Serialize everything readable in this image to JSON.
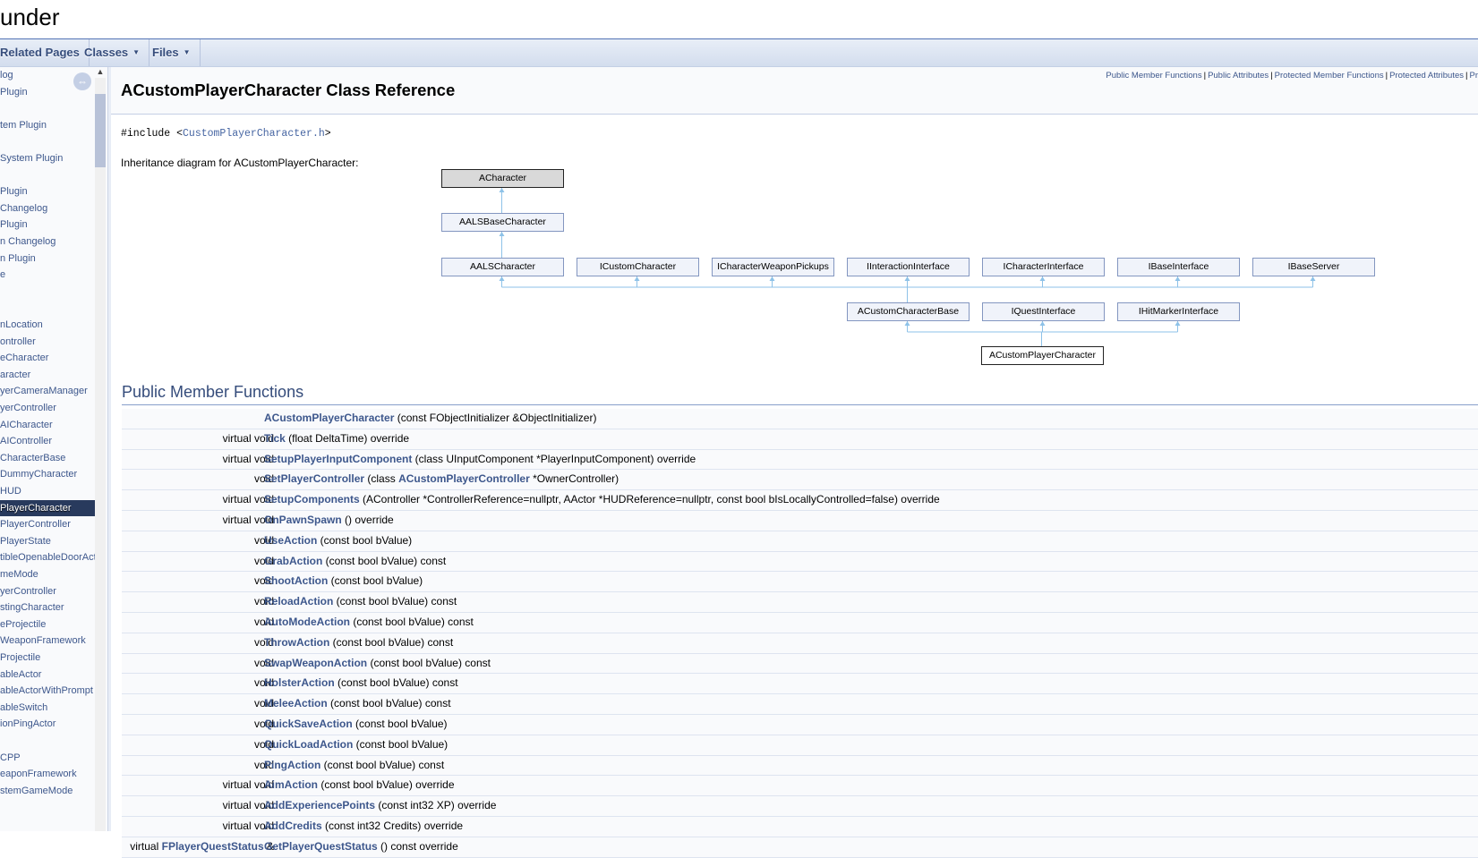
{
  "project": {
    "name": "under"
  },
  "nav": {
    "items": [
      {
        "label": "Related Pages",
        "has_dropdown": false
      },
      {
        "label": "Classes",
        "has_dropdown": true
      },
      {
        "label": "Files",
        "has_dropdown": true
      }
    ],
    "caret": "▼"
  },
  "sidenav": {
    "sync_icon": "⇔",
    "scroll_up": "▲",
    "items": [
      "log",
      "Plugin",
      "",
      "tem Plugin",
      "",
      "System Plugin",
      "",
      "Plugin",
      "Changelog",
      "Plugin",
      "n Changelog",
      "n Plugin",
      "e",
      "",
      "",
      "nLocation",
      "ontroller",
      "eCharacter",
      "aracter",
      "yerCameraManager",
      "yerController",
      "AICharacter",
      "AIController",
      "CharacterBase",
      "DummyCharacter",
      "HUD",
      "PlayerCharacter",
      "PlayerController",
      "PlayerState",
      "tibleOpenableDoorActor",
      "meMode",
      "yerController",
      "stingCharacter",
      "eProjectile",
      "WeaponFramework",
      "Projectile",
      "ableActor",
      "ableActorWithPrompt",
      "ableSwitch",
      "ionPingActor",
      "",
      "CPP",
      "eaponFramework",
      "stemGameMode"
    ],
    "selected_index": 26
  },
  "summary_links": [
    "Public Member Functions",
    "Public Attributes",
    "Protected Member Functions",
    "Protected Attributes",
    "Pr"
  ],
  "page": {
    "title": "ACustomPlayerCharacter Class Reference",
    "include_prefix": "#include <",
    "include_file": "CustomPlayerCharacter.h",
    "include_suffix": ">",
    "inheritance_label": "Inheritance diagram for ACustomPlayerCharacter:"
  },
  "diagram": {
    "root": "ACharacter",
    "level1": "AALSBaseCharacter",
    "level2": [
      "AALSCharacter",
      "ICustomCharacter",
      "ICharacterWeaponPickups",
      "IInteractionInterface",
      "ICharacterInterface",
      "IBaseInterface",
      "IBaseServer"
    ],
    "level3": [
      "ACustomCharacterBase",
      "IQuestInterface",
      "IHitMarkerInterface"
    ],
    "current": "ACustomPlayerCharacter",
    "line_color": "#8ec2e8"
  },
  "section": {
    "title": "Public Member Functions"
  },
  "members": [
    {
      "ret": "",
      "name": "ACustomPlayerCharacter",
      "sig": " (const FObjectInitializer &ObjectInitializer)"
    },
    {
      "ret": "virtual void",
      "name": "Tick",
      "sig": " (float DeltaTime) override"
    },
    {
      "ret": "virtual void",
      "name": "SetupPlayerInputComponent",
      "sig": " (class UInputComponent *PlayerInputComponent) override"
    },
    {
      "ret": "void",
      "name": "SetPlayerController",
      "sig_pre": " (class ",
      "sig_link": "ACustomPlayerController",
      "sig": " *OwnerController)"
    },
    {
      "ret": "virtual void",
      "name": "SetupComponents",
      "sig": " (AController *ControllerReference=nullptr, AActor *HUDReference=nullptr, const bool bIsLocallyControlled=false) override"
    },
    {
      "ret": "virtual void",
      "name": "OnPawnSpawn",
      "sig": " () override"
    },
    {
      "ret": "void",
      "name": "UseAction",
      "sig": " (const bool bValue)"
    },
    {
      "ret": "void",
      "name": "GrabAction",
      "sig": " (const bool bValue) const"
    },
    {
      "ret": "void",
      "name": "ShootAction",
      "sig": " (const bool bValue)"
    },
    {
      "ret": "void",
      "name": "ReloadAction",
      "sig": " (const bool bValue) const"
    },
    {
      "ret": "void",
      "name": "AutoModeAction",
      "sig": " (const bool bValue) const"
    },
    {
      "ret": "void",
      "name": "ThrowAction",
      "sig": " (const bool bValue) const"
    },
    {
      "ret": "void",
      "name": "SwapWeaponAction",
      "sig": " (const bool bValue) const"
    },
    {
      "ret": "void",
      "name": "HolsterAction",
      "sig": " (const bool bValue) const"
    },
    {
      "ret": "void",
      "name": "MeleeAction",
      "sig": " (const bool bValue) const"
    },
    {
      "ret": "void",
      "name": "QuickSaveAction",
      "sig": " (const bool bValue)"
    },
    {
      "ret": "void",
      "name": "QuickLoadAction",
      "sig": " (const bool bValue)"
    },
    {
      "ret": "void",
      "name": "PingAction",
      "sig": " (const bool bValue) const"
    },
    {
      "ret": "virtual void",
      "name": "AimAction",
      "sig": " (const bool bValue) override"
    },
    {
      "ret": "virtual void",
      "name": "AddExperiencePoints",
      "sig": " (const int32 XP) override"
    },
    {
      "ret": "virtual void",
      "name": "AddCredits",
      "sig": " (const int32 Credits) override"
    },
    {
      "ret_pre": "virtual ",
      "ret_link": "FPlayerQuestStatus",
      "ret": " &",
      "name": "GetPlayerQuestStatus",
      "sig": " () const override"
    }
  ]
}
